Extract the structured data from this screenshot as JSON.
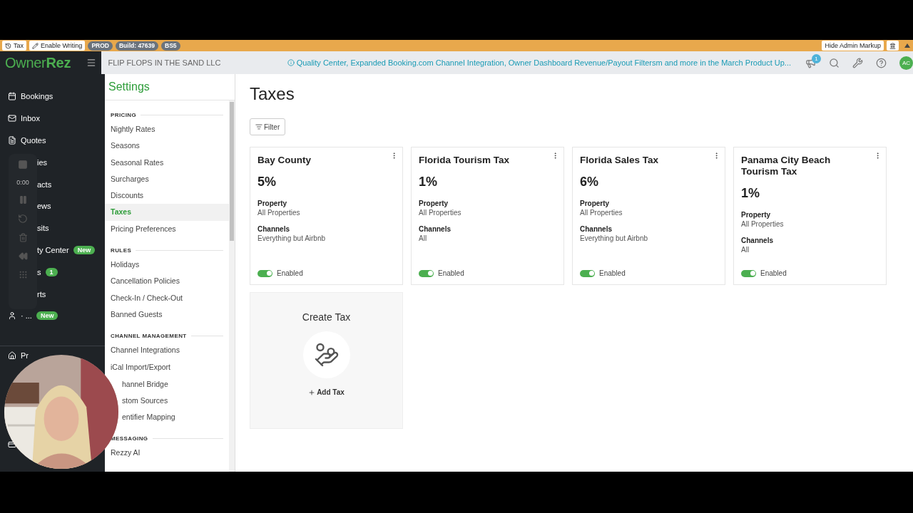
{
  "admin_bar": {
    "buttons": [
      {
        "label": "Tax"
      },
      {
        "label": "Enable Writing"
      }
    ],
    "badges": [
      "PROD",
      "Build: 47639",
      "BS5"
    ],
    "right_button": "Hide Admin Markup"
  },
  "header": {
    "logo_light": "Owner",
    "logo_bold": "Rez",
    "company": "FLIP FLOPS IN THE SAND LLC",
    "announcement": "Quality Center, Expanded Booking.com Channel Integration, Owner Dashboard Revenue/Payout Filtersm and more in the March Product Up...",
    "notifications": "1",
    "avatar": "AC"
  },
  "sidebar": {
    "items": [
      {
        "label": "Bookings",
        "kind": "full"
      },
      {
        "label": "Inbox",
        "kind": "full"
      },
      {
        "label": "Quotes",
        "kind": "full"
      },
      {
        "label": "ies",
        "kind": "covered"
      },
      {
        "label": "acts",
        "kind": "covered"
      },
      {
        "label": "ews",
        "kind": "covered"
      },
      {
        "label": "sits",
        "kind": "covered"
      },
      {
        "label": "ty Center",
        "kind": "covered",
        "badge": "New"
      },
      {
        "label": "s",
        "kind": "covered",
        "badge": "1"
      },
      {
        "label": "rts",
        "kind": "covered"
      },
      {
        "label": "· ...",
        "kind": "full",
        "badge": "New"
      }
    ],
    "bottom_items": [
      {
        "label": "Pr"
      }
    ]
  },
  "recorder": {
    "time": "0:00"
  },
  "settings": {
    "title": "Settings",
    "sections": [
      {
        "heading": "PRICING",
        "items": [
          {
            "label": "Nightly Rates",
            "selected": false
          },
          {
            "label": "Seasons",
            "selected": false
          },
          {
            "label": "Seasonal Rates",
            "selected": false
          },
          {
            "label": "Surcharges",
            "selected": false
          },
          {
            "label": "Discounts",
            "selected": false
          },
          {
            "label": "Taxes",
            "selected": true
          },
          {
            "label": "Pricing Preferences",
            "selected": false
          }
        ]
      },
      {
        "heading": "RULES",
        "items": [
          {
            "label": "Holidays",
            "selected": false
          },
          {
            "label": "Cancellation Policies",
            "selected": false
          },
          {
            "label": "Check-In / Check-Out",
            "selected": false
          },
          {
            "label": "Banned Guests",
            "selected": false
          }
        ]
      },
      {
        "heading": "CHANNEL MANAGEMENT",
        "items": [
          {
            "label": "Channel Integrations",
            "selected": false
          },
          {
            "label": "iCal Import/Export",
            "selected": false
          },
          {
            "label": "hannel Bridge",
            "selected": false,
            "kind": "covered"
          },
          {
            "label": "stom Sources",
            "selected": false,
            "kind": "covered"
          },
          {
            "label": "entifier Mapping",
            "selected": false,
            "kind": "covered"
          }
        ]
      },
      {
        "heading": "MESSAGING",
        "items": [
          {
            "label": "Rezzy AI",
            "selected": false
          }
        ]
      }
    ]
  },
  "page": {
    "title": "Taxes",
    "filter": "Filter",
    "taxes": [
      {
        "name": "Bay County",
        "rate": "5%",
        "property_label": "Property",
        "property": "All Properties",
        "channels_label": "Channels",
        "channels": "Everything but Airbnb",
        "enabled": true,
        "status": "Enabled"
      },
      {
        "name": "Florida Tourism Tax",
        "rate": "1%",
        "property_label": "Property",
        "property": "All Properties",
        "channels_label": "Channels",
        "channels": "All",
        "enabled": true,
        "status": "Enabled"
      },
      {
        "name": "Florida Sales Tax",
        "rate": "6%",
        "property_label": "Property",
        "property": "All Properties",
        "channels_label": "Channels",
        "channels": "Everything but Airbnb",
        "enabled": true,
        "status": "Enabled"
      },
      {
        "name": "Panama City Beach Tourism Tax",
        "rate": "1%",
        "property_label": "Property",
        "property": "All Properties",
        "channels_label": "Channels",
        "channels": "All",
        "enabled": true,
        "status": "Enabled"
      }
    ],
    "create": {
      "title": "Create Tax",
      "action": "Add Tax"
    }
  }
}
